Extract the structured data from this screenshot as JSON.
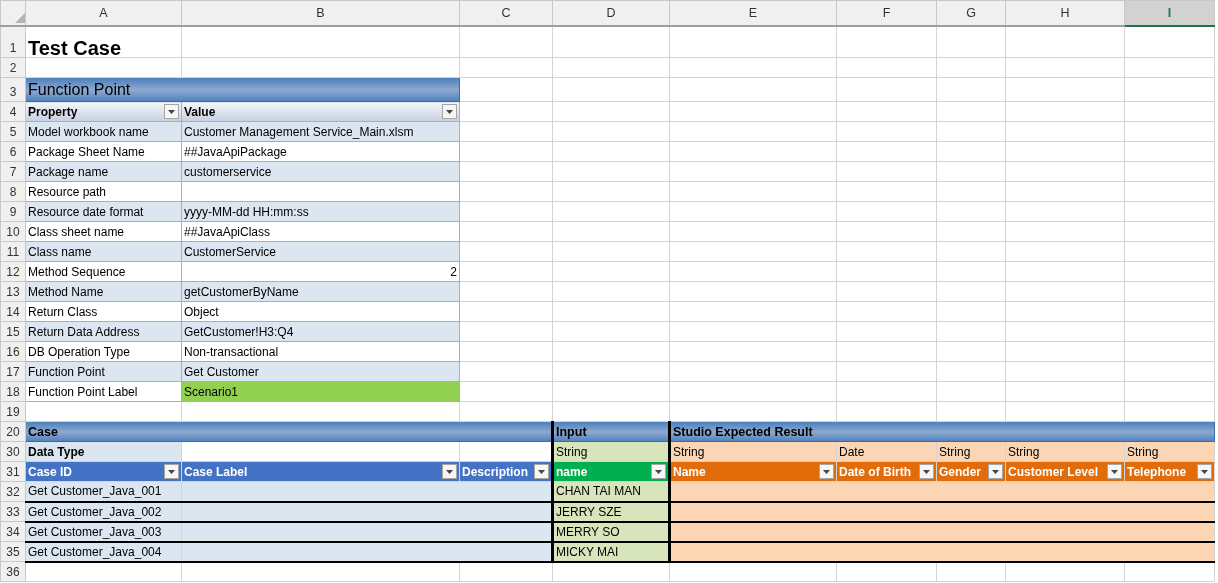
{
  "column_headers": [
    {
      "label": "A",
      "selected": false
    },
    {
      "label": "B",
      "selected": false
    },
    {
      "label": "C",
      "selected": false
    },
    {
      "label": "D",
      "selected": false
    },
    {
      "label": "E",
      "selected": false
    },
    {
      "label": "F",
      "selected": false
    },
    {
      "label": "G",
      "selected": false
    },
    {
      "label": "H",
      "selected": false
    },
    {
      "label": "I",
      "selected": true
    }
  ],
  "rows": [
    {
      "number": "1",
      "kind": "title",
      "text": "Test Case"
    },
    {
      "number": "2",
      "kind": "blank"
    },
    {
      "number": "3",
      "kind": "fp_band",
      "text": "Function Point"
    },
    {
      "number": "4",
      "kind": "fp_header",
      "labels": [
        "Property",
        "Value"
      ]
    },
    {
      "number": "5",
      "kind": "fp_row",
      "property": "Model workbook name",
      "value": "Customer Management Service_Main.xlsm",
      "banded": true,
      "numeric": false,
      "highlight": false
    },
    {
      "number": "6",
      "kind": "fp_row",
      "property": "Package Sheet Name",
      "value": "##JavaApiPackage",
      "banded": false,
      "numeric": false,
      "highlight": false
    },
    {
      "number": "7",
      "kind": "fp_row",
      "property": "Package name",
      "value": "customerservice",
      "banded": true,
      "numeric": false,
      "highlight": false
    },
    {
      "number": "8",
      "kind": "fp_row",
      "property": "Resource path",
      "banded": false,
      "numeric": false,
      "highlight": false
    },
    {
      "number": "9",
      "kind": "fp_row",
      "property": "Resource date format",
      "value": "yyyy-MM-dd HH:mm:ss",
      "banded": true,
      "numeric": false,
      "highlight": false
    },
    {
      "number": "10",
      "kind": "fp_row",
      "property": "Class sheet name",
      "value": "##JavaApiClass",
      "banded": false,
      "numeric": false,
      "highlight": false
    },
    {
      "number": "11",
      "kind": "fp_row",
      "property": "Class name",
      "value": "CustomerService",
      "banded": true,
      "numeric": false,
      "highlight": false
    },
    {
      "number": "12",
      "kind": "fp_row",
      "property": "Method Sequence",
      "value": "2",
      "banded": false,
      "numeric": true,
      "highlight": false
    },
    {
      "number": "13",
      "kind": "fp_row",
      "property": "Method Name",
      "value": "getCustomerByName",
      "banded": true,
      "numeric": false,
      "highlight": false
    },
    {
      "number": "14",
      "kind": "fp_row",
      "property": "Return Class",
      "value": "Object",
      "banded": false,
      "numeric": false,
      "highlight": false
    },
    {
      "number": "15",
      "kind": "fp_row",
      "property": "Return Data Address",
      "value": "GetCustomer!H3:Q4",
      "banded": true,
      "numeric": false,
      "highlight": false
    },
    {
      "number": "16",
      "kind": "fp_row",
      "property": "DB Operation Type",
      "value": "Non-transactional",
      "banded": false,
      "numeric": false,
      "highlight": false
    },
    {
      "number": "17",
      "kind": "fp_row",
      "property": "Function Point",
      "value": "Get Customer",
      "banded": true,
      "numeric": false,
      "highlight": false
    },
    {
      "number": "18",
      "kind": "fp_row",
      "property": "Function Point Label",
      "value": "Scenario1",
      "banded": false,
      "numeric": false,
      "highlight": true
    },
    {
      "number": "19",
      "kind": "blank"
    },
    {
      "number": "20",
      "kind": "case_band",
      "cells": [
        {
          "text": "Case",
          "kind": "case"
        },
        {
          "text": "Input",
          "kind": "input"
        },
        {
          "text": "Studio Expected Result",
          "kind": "result"
        }
      ]
    },
    {
      "number": "30",
      "kind": "type_row",
      "label": "Data Type",
      "types": [
        {
          "text": "String",
          "kind": "input"
        },
        {
          "text": "String",
          "kind": "result"
        },
        {
          "text": "Date",
          "kind": "result"
        },
        {
          "text": "String",
          "kind": "result"
        },
        {
          "text": "String",
          "kind": "result"
        },
        {
          "text": "String",
          "kind": "result"
        }
      ]
    },
    {
      "number": "31",
      "kind": "case_header",
      "columns": [
        {
          "label": "Case ID",
          "kind": "case"
        },
        {
          "label": "Case Label",
          "kind": "case"
        },
        {
          "label": "Description",
          "kind": "case"
        },
        {
          "label": "name",
          "kind": "input"
        },
        {
          "label": "Name",
          "kind": "result"
        },
        {
          "label": "Date of Birth",
          "kind": "result"
        },
        {
          "label": "Gender",
          "kind": "result"
        },
        {
          "label": "Customer Level",
          "kind": "result"
        },
        {
          "label": "Telephone",
          "kind": "result"
        }
      ]
    },
    {
      "number": "32",
      "kind": "case_row",
      "case_id": "Get Customer_Java_001",
      "input": "CHAN TAI MAN"
    },
    {
      "number": "33",
      "kind": "case_row",
      "case_id": "Get Customer_Java_002",
      "input": "JERRY SZE"
    },
    {
      "number": "34",
      "kind": "case_row",
      "case_id": "Get Customer_Java_003",
      "input": "MERRY SO"
    },
    {
      "number": "35",
      "kind": "case_row",
      "case_id": "Get Customer_Java_004",
      "input": "MICKY MAI"
    },
    {
      "number": "36",
      "kind": "blank"
    }
  ]
}
